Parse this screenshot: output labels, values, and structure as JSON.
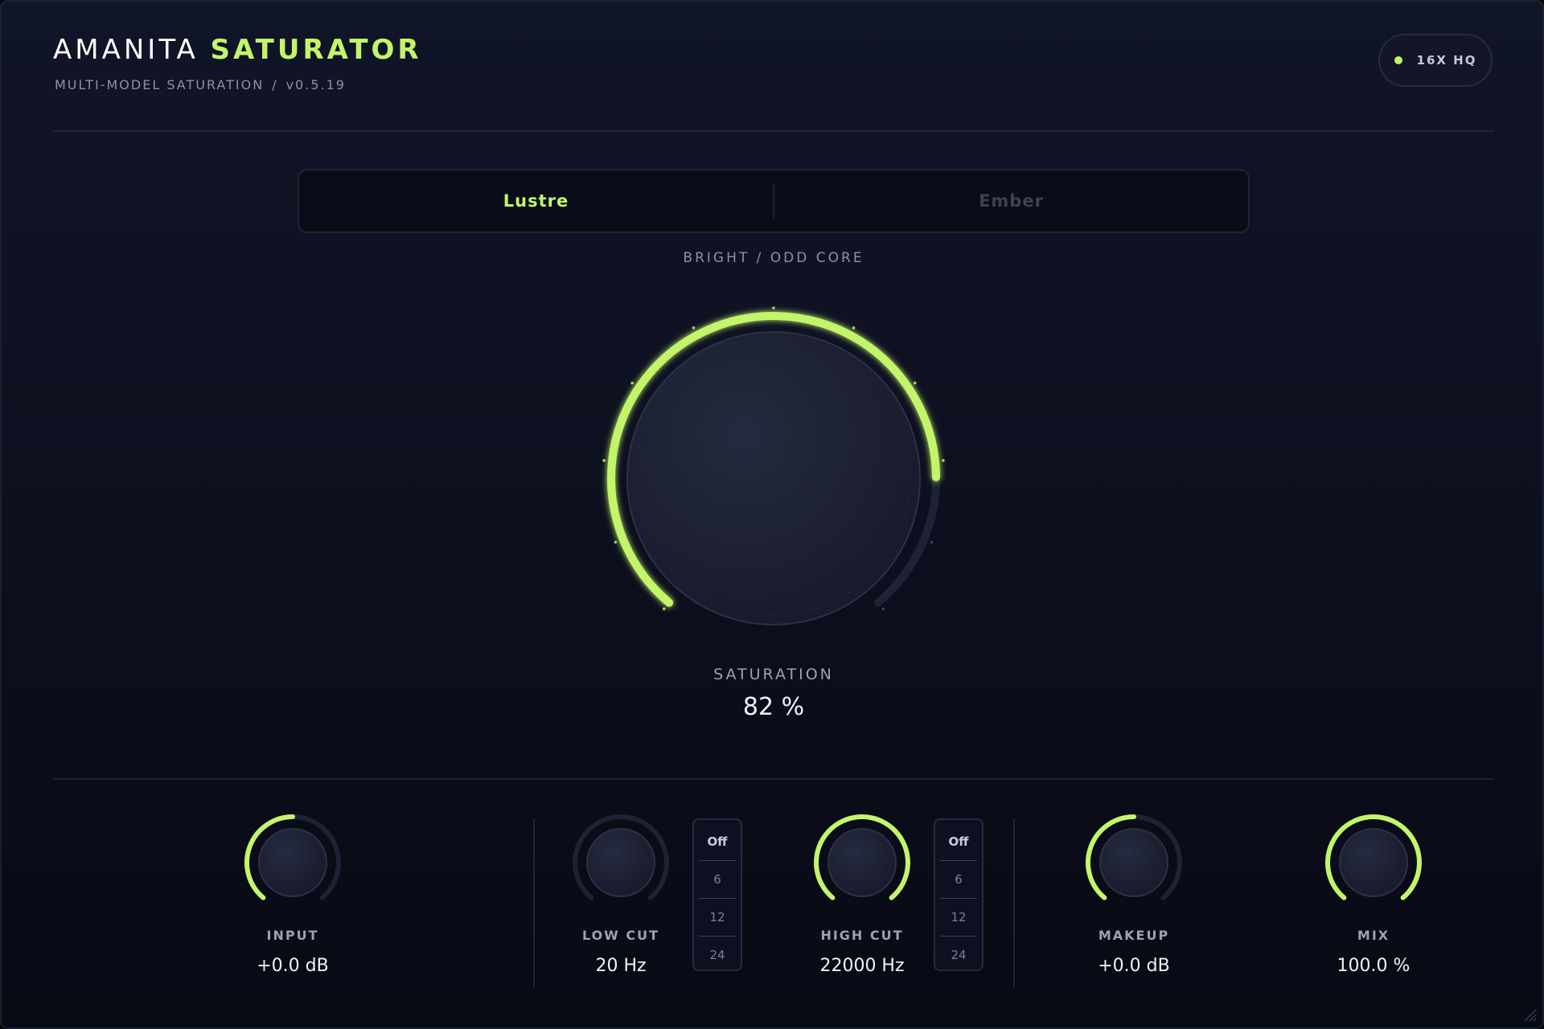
{
  "header": {
    "title_main": "AMANITA",
    "title_accent": "SATURATOR",
    "subtitle": "MULTI-MODEL SATURATION",
    "subtitle_sep": "/",
    "version": "v0.5.19",
    "quality_badge": "16X HQ"
  },
  "models": {
    "tabs": [
      {
        "label": "Lustre",
        "active": true
      },
      {
        "label": "Ember",
        "active": false
      }
    ],
    "description": "BRIGHT / ODD CORE"
  },
  "saturation": {
    "label": "SATURATION",
    "value_text": "82 %",
    "value": 82
  },
  "params": [
    {
      "label": "INPUT",
      "value_text": "+0.0 dB",
      "level": 0.5
    },
    {
      "label": "LOW CUT",
      "value_text": "20 Hz",
      "level": 0.0
    },
    {
      "label": "HIGH CUT",
      "value_text": "22000 Hz",
      "level": 1.0
    },
    {
      "label": "MAKEUP",
      "value_text": "+0.0 dB",
      "level": 0.5
    },
    {
      "label": "MIX",
      "value_text": "100.0 %",
      "level": 1.0
    }
  ],
  "slopes": {
    "low_cut": {
      "options": [
        "Off",
        "6",
        "12",
        "24"
      ],
      "selected": "Off"
    },
    "high_cut": {
      "options": [
        "Off",
        "6",
        "12",
        "24"
      ],
      "selected": "Off"
    }
  },
  "colors": {
    "accent": "#c3f56a",
    "track": "#1e2236",
    "background": "#0c0f1d"
  },
  "icons": {
    "status_dot": "status-dot-icon",
    "resize_handle": "resize-grip-icon"
  }
}
